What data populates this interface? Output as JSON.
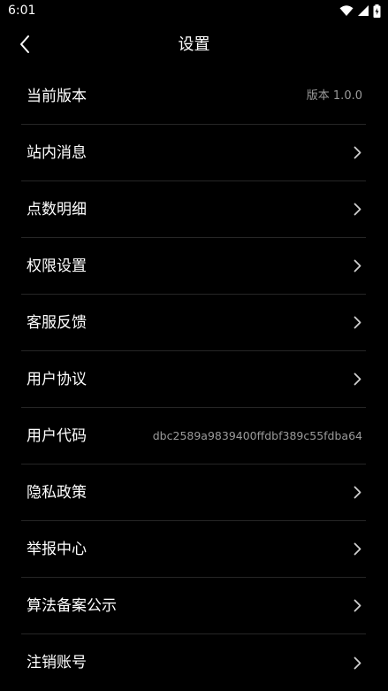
{
  "status_bar": {
    "time": "6:01",
    "icons": [
      "wifi-icon",
      "cell-signal-icon",
      "battery-icon"
    ]
  },
  "app_bar": {
    "title": "设置",
    "back_icon": "chevron-left-icon"
  },
  "settings": {
    "items": [
      {
        "label": "当前版本",
        "value": "版本 1.0.0"
      },
      {
        "label": "站内消息"
      },
      {
        "label": "点数明细"
      },
      {
        "label": "权限设置"
      },
      {
        "label": "客服反馈"
      },
      {
        "label": "用户协议"
      },
      {
        "label": "用户代码",
        "value": "dbc2589a9839400ffdbf389c55fdba64"
      },
      {
        "label": "隐私政策"
      },
      {
        "label": "举报中心"
      },
      {
        "label": "算法备案公示"
      },
      {
        "label": "注销账号"
      }
    ]
  },
  "colors": {
    "background": "#000000",
    "text": "#ffffff",
    "secondary_text": "#9a9a9a",
    "divider": "#262626"
  }
}
